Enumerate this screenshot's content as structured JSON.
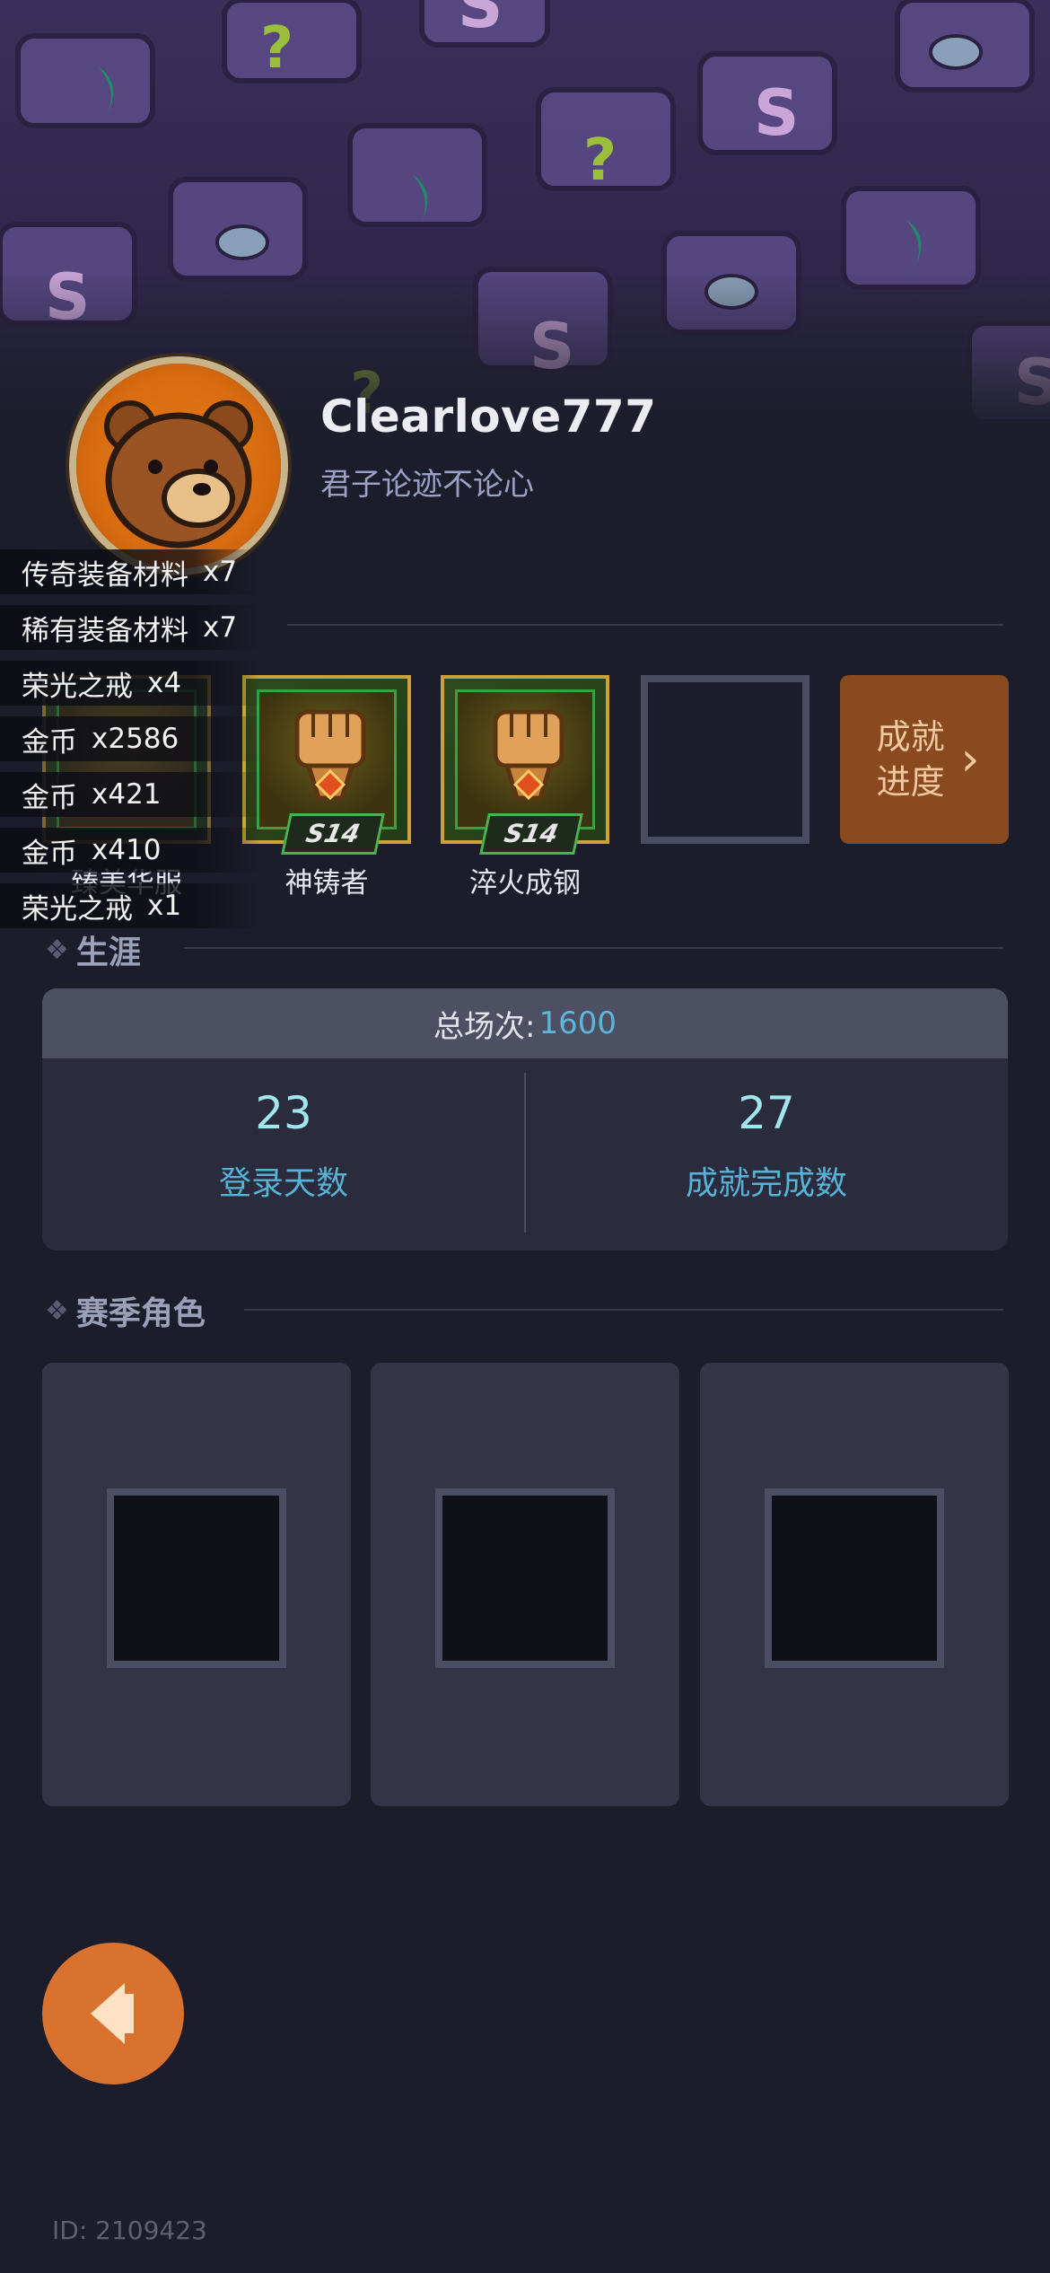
{
  "profile": {
    "username": "Clearlove777",
    "signature": "君子论迹不论心",
    "id_text": "ID: 2109423"
  },
  "rewards": [
    {
      "name": "传奇装备材料",
      "qty": "x7"
    },
    {
      "name": "稀有装备材料",
      "qty": "x7"
    },
    {
      "name": "荣光之戒",
      "qty": "x4"
    },
    {
      "name": "金币",
      "qty": "x2586"
    },
    {
      "name": "金币",
      "qty": "x421"
    },
    {
      "name": "金币",
      "qty": "x410"
    },
    {
      "name": "荣光之戒",
      "qty": "x1"
    }
  ],
  "badges": [
    {
      "label": "臻美华服",
      "season": ""
    },
    {
      "label": "神铸者",
      "season": "S14"
    },
    {
      "label": "淬火成钢",
      "season": "S14"
    }
  ],
  "achievement_button": {
    "line1": "成就",
    "line2": "进度",
    "chevron": "›"
  },
  "career": {
    "title": "生涯",
    "total_label": "总场次:",
    "total_value": "1600",
    "stats": [
      {
        "value": "23",
        "label": "登录天数"
      },
      {
        "value": "27",
        "label": "成就完成数"
      }
    ]
  },
  "season_roles": {
    "title": "赛季角色"
  },
  "icons": {
    "section_marker": "diamond-cluster-icon",
    "back": "back-arrow-icon",
    "badge": "fist-emblem-icon"
  },
  "colors": {
    "accent_orange": "#d9722e",
    "stat_value": "#9fe6ee",
    "stat_label": "#56b3d5",
    "total_value": "#5fb5d8"
  }
}
